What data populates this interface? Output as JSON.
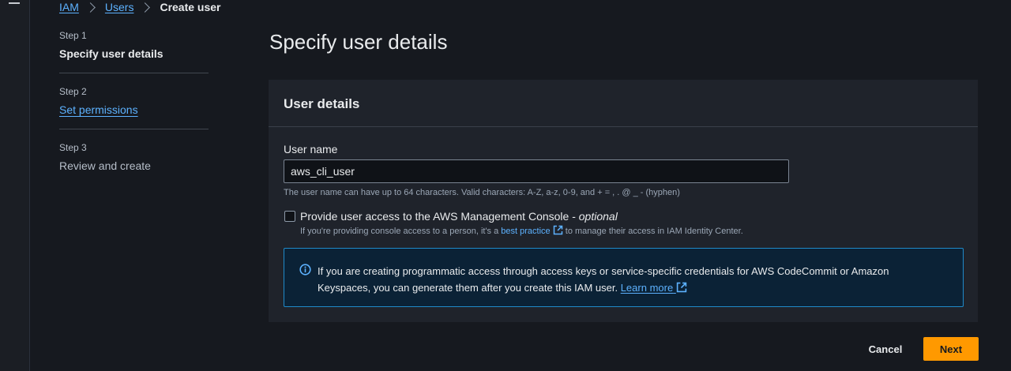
{
  "breadcrumb": {
    "items": [
      "IAM",
      "Users"
    ],
    "current": "Create user"
  },
  "steps": [
    {
      "number": "Step 1",
      "title": "Specify user details"
    },
    {
      "number": "Step 2",
      "title": "Set permissions"
    },
    {
      "number": "Step 3",
      "title": "Review and create"
    }
  ],
  "page": {
    "title": "Specify user details"
  },
  "panel": {
    "title": "User details",
    "username_label": "User name",
    "username_value": "aws_cli_user",
    "username_hint": "The user name can have up to 64 characters. Valid characters: A-Z, a-z, 0-9, and + = , . @ _ - (hyphen)",
    "console_checkbox": {
      "label": "Provide user access to the AWS Management Console - ",
      "optional": "optional",
      "checked": false,
      "desc_before": "If you're providing console access to a person, it's a ",
      "desc_link": "best practice",
      "desc_after": " to manage their access in IAM Identity Center."
    },
    "info": {
      "text": "If you are creating programmatic access through access keys or service-specific credentials for AWS CodeCommit or Amazon Keyspaces, you can generate them after you create this IAM user. ",
      "link": "Learn more"
    }
  },
  "footer": {
    "cancel": "Cancel",
    "next": "Next"
  },
  "colors": {
    "accent": "#ff9900",
    "link": "#5db2ff",
    "info_border": "#1f8ac9"
  }
}
